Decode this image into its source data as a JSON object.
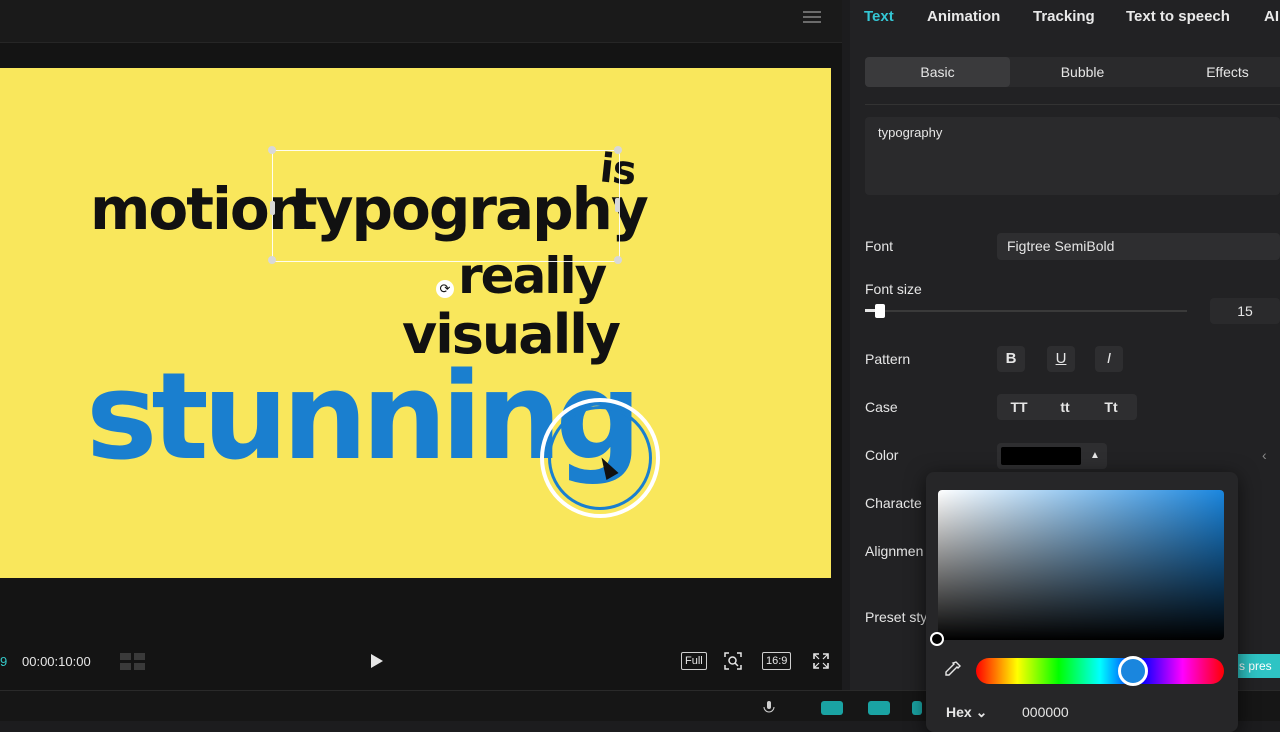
{
  "player": {
    "canvas_words": {
      "motion": "motion",
      "typography": "typography",
      "is": "is",
      "really": "really",
      "visually": "visually",
      "stunning": "stunning"
    },
    "canvas_background": "#f9e75c",
    "accent_text_color": "#1a7fcf",
    "time_prefix": "9",
    "time_total": "00:00:10:00",
    "full_label": "Full",
    "ratio_label": "16:9"
  },
  "properties": {
    "tabs": [
      {
        "label": "Text",
        "active": true
      },
      {
        "label": "Animation"
      },
      {
        "label": "Tracking"
      },
      {
        "label": "Text to speech"
      },
      {
        "label": "AI"
      }
    ],
    "subtabs": [
      {
        "label": "Basic",
        "active": true
      },
      {
        "label": "Bubble"
      },
      {
        "label": "Effects"
      }
    ],
    "text_value": "typography",
    "font_label": "Font",
    "font_value": "Figtree SemiBold",
    "font_size_label": "Font size",
    "font_size_value": "15",
    "pattern_label": "Pattern",
    "pattern_buttons": [
      "B",
      "U",
      "I"
    ],
    "case_label": "Case",
    "case_buttons": [
      "TT",
      "tt",
      "Tt"
    ],
    "color_label": "Color",
    "character_label": "Characte",
    "alignment_label": "Alignmen",
    "preset_label": "Preset sty",
    "preset_button": "s pres"
  },
  "color_picker": {
    "hex_label": "Hex",
    "hex_value": "000000",
    "current_color": "#000000",
    "hue_color": "#1a86de"
  }
}
